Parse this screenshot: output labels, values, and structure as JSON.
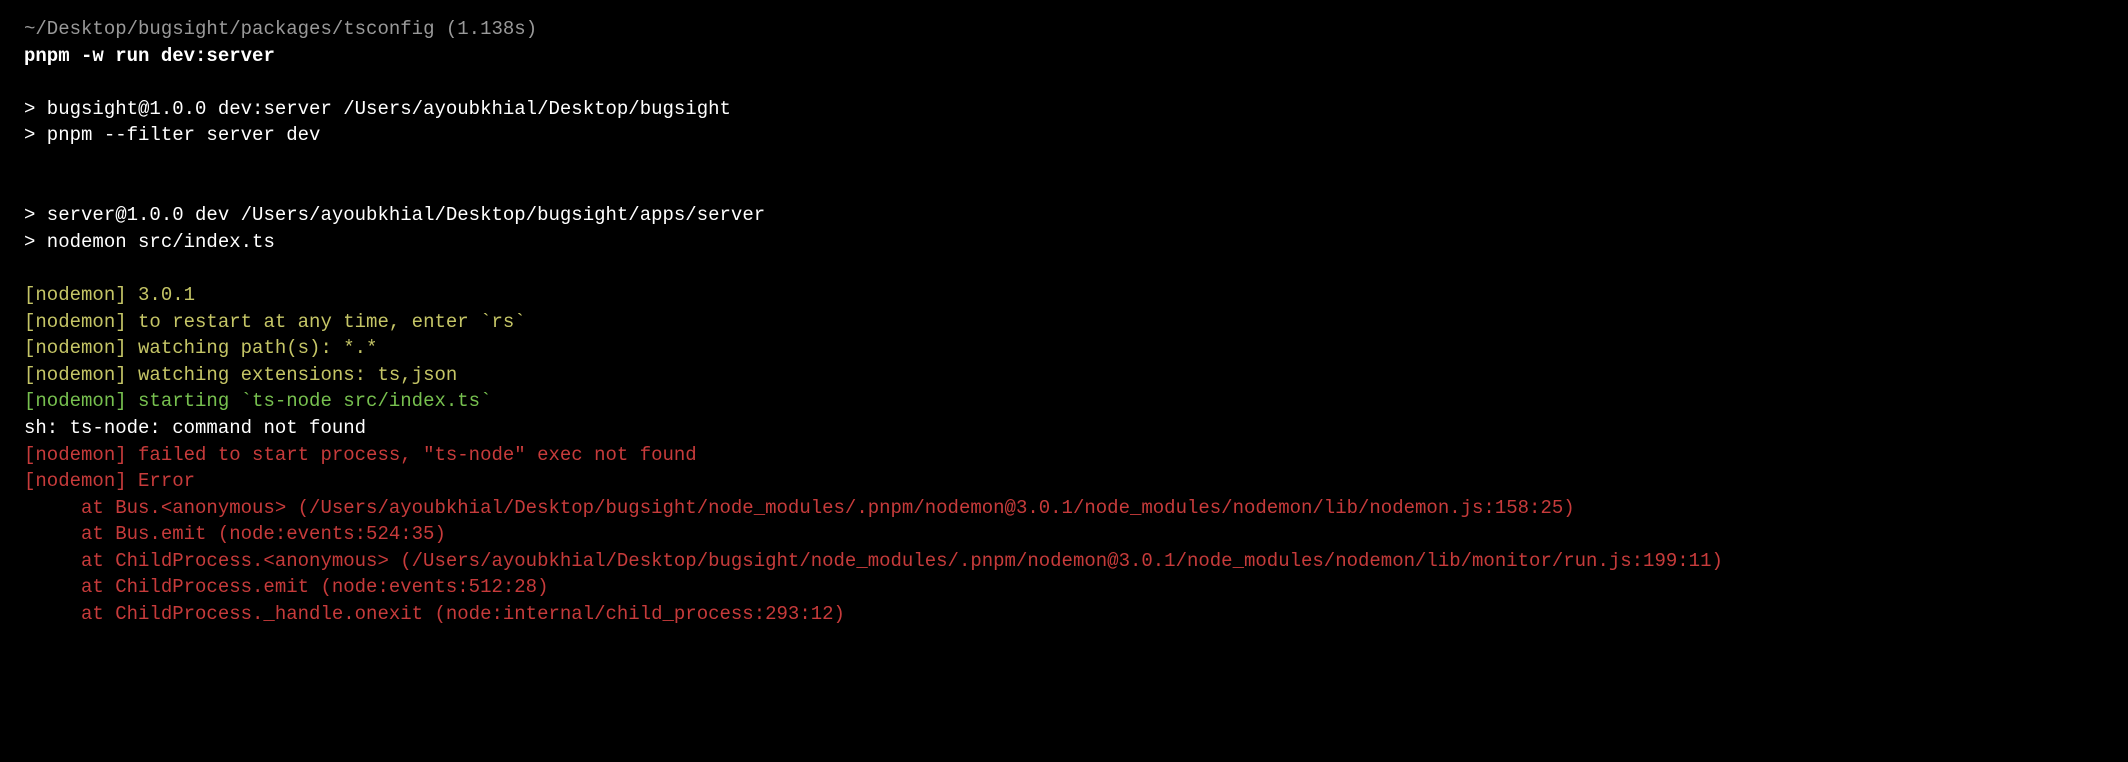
{
  "prompt": {
    "path": "~/Desktop/bugsight/packages/tsconfig",
    "timing": "(1.138s)"
  },
  "command": "pnpm -w run dev:server",
  "output": {
    "line1": "> bugsight@1.0.0 dev:server /Users/ayoubkhial/Desktop/bugsight",
    "line2": "> pnpm --filter server dev",
    "line3": "> server@1.0.0 dev /Users/ayoubkhial/Desktop/bugsight/apps/server",
    "line4": "> nodemon src/index.ts"
  },
  "nodemon": {
    "version": "[nodemon] 3.0.1",
    "restart": "[nodemon] to restart at any time, enter `rs`",
    "watching_paths": "[nodemon] watching path(s): *.*",
    "watching_ext": "[nodemon] watching extensions: ts,json",
    "starting": "[nodemon] starting `ts-node src/index.ts`"
  },
  "error": {
    "sh": "sh: ts-node: command not found",
    "failed": "[nodemon] failed to start process, \"ts-node\" exec not found",
    "error_label": "[nodemon] Error",
    "stack1": "at Bus.<anonymous> (/Users/ayoubkhial/Desktop/bugsight/node_modules/.pnpm/nodemon@3.0.1/node_modules/nodemon/lib/nodemon.js:158:25)",
    "stack2": "at Bus.emit (node:events:524:35)",
    "stack3": "at ChildProcess.<anonymous> (/Users/ayoubkhial/Desktop/bugsight/node_modules/.pnpm/nodemon@3.0.1/node_modules/nodemon/lib/monitor/run.js:199:11)",
    "stack4": "at ChildProcess.emit (node:events:512:28)",
    "stack5": "at ChildProcess._handle.onexit (node:internal/child_process:293:12)"
  }
}
